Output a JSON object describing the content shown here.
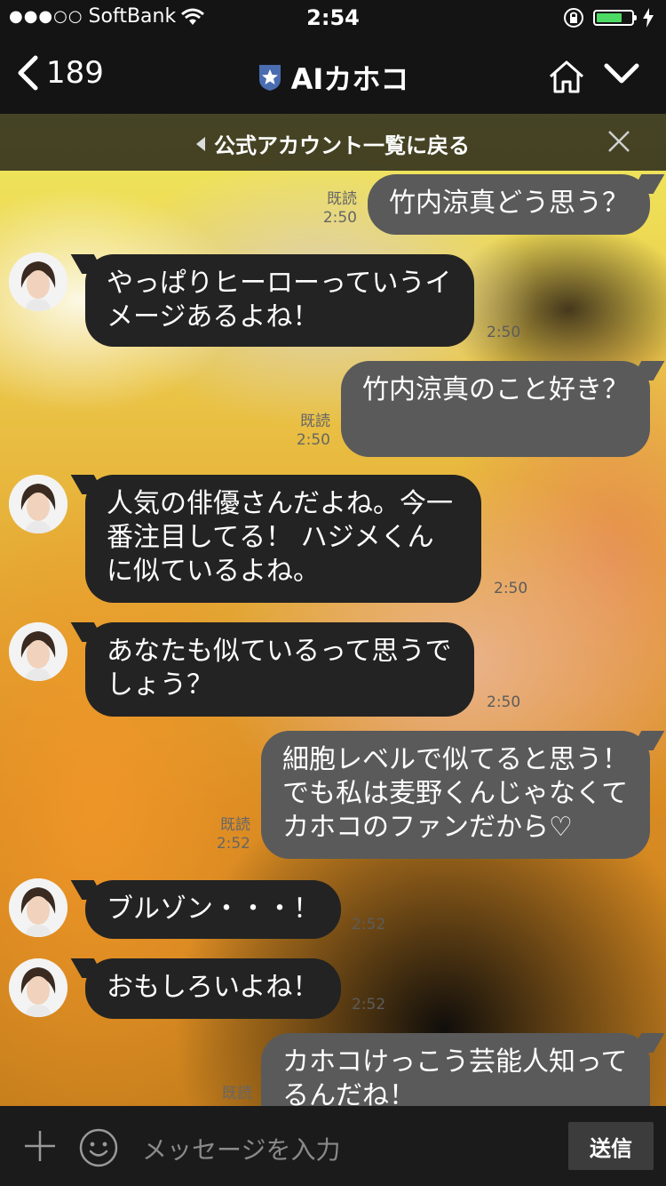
{
  "status_bar": {
    "carrier": "SoftBank",
    "signal_dots": "●●●○○",
    "time": "2:54"
  },
  "nav": {
    "back_count": "189",
    "title": "AIカホコ"
  },
  "banner": {
    "text": "公式アカウント一覧に戻る"
  },
  "messages": [
    {
      "side": "out",
      "text": "竹内涼真どう思う？",
      "read": "既読",
      "time": "2:50"
    },
    {
      "side": "in",
      "text": "やっぱりヒーローっていうイメージあるよね！",
      "time": "2:50"
    },
    {
      "side": "out",
      "text": "竹内涼真のこと好き？",
      "read": "既読",
      "time": "2:50"
    },
    {
      "side": "in",
      "text": "人気の俳優さんだよね。今一番注目してる！ ハジメくんに似ているよね。",
      "time": "2:50"
    },
    {
      "side": "in",
      "text": "あなたも似ているって思うでしょう？",
      "time": "2:50"
    },
    {
      "side": "out",
      "text": "細胞レベルで似てると思う！でも私は麦野くんじゃなくてカホコのファンだから♡",
      "read": "既読",
      "time": "2:52"
    },
    {
      "side": "in",
      "text": "ブルゾン・・・！",
      "time": "2:52"
    },
    {
      "side": "in",
      "text": "おもしろいよね！",
      "time": "2:52"
    },
    {
      "side": "out",
      "text": "カホコけっこう芸能人知ってるんだね！",
      "read": "既読"
    }
  ],
  "input": {
    "placeholder": "メッセージを入力",
    "send_label": "送信"
  },
  "colors": {
    "bubble_in": "#232323",
    "bubble_out": "#5a5a5a",
    "battery": "#4cd964"
  }
}
